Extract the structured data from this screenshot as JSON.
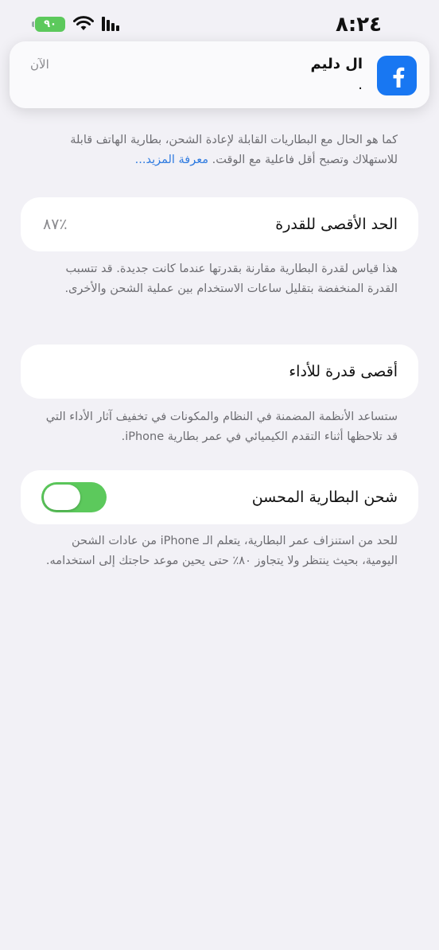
{
  "status_bar": {
    "time": "٨:٢٤",
    "battery_level": "٩٠",
    "colors": {
      "battery": "#5CC95C"
    }
  },
  "notification": {
    "app_icon": "facebook-icon",
    "title": "ال دليم",
    "body": ".",
    "time": "الآن"
  },
  "intro": {
    "text": "كما هو الحال مع البطاريات القابلة لإعادة الشحن، بطارية الهاتف قابلة للاستهلاك وتصبح أقل فاعلية مع الوقت. ",
    "link": "معرفة المزيد..."
  },
  "max_capacity": {
    "label": "الحد الأقصى للقدرة",
    "value": "٪٨٧",
    "description": "هذا قياس لقدرة البطارية مقارنة بقدرتها عندما كانت جديدة. قد تتسبب القدرة المنخفضة بتقليل ساعات الاستخدام بين عملية الشحن والأخرى."
  },
  "peak_performance": {
    "label": "أقصى قدرة للأداء",
    "description": "ستساعد الأنظمة المضمنة في النظام والمكونات في تخفيف آثار الأداء التي قد تلاحظها أثناء التقدم الكيميائي في عمر بطارية iPhone."
  },
  "optimized_charging": {
    "label": "شحن البطارية المحسن",
    "enabled": true,
    "description": "للحد من استنزاف عمر البطارية، يتعلم الـ iPhone من عادات الشحن اليومية، بحيث ينتظر ولا يتجاوز ٨٠٪ حتى يحين موعد حاجتك إلى استخدامه.",
    "colors": {
      "toggle_on": "#5CC95C"
    }
  }
}
